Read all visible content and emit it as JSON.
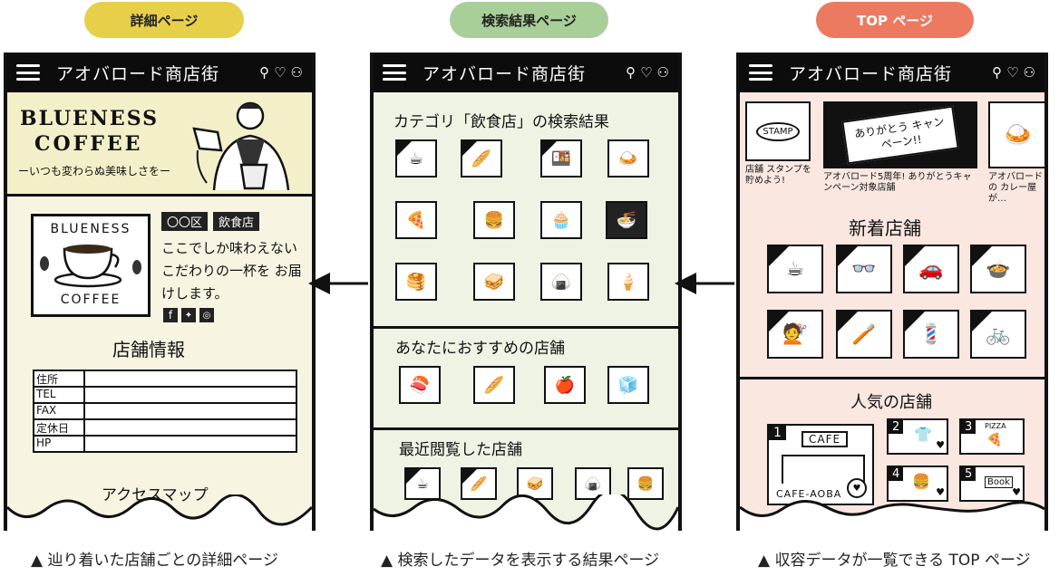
{
  "pills": [
    {
      "label": "詳細ページ",
      "color": "#e8cf4a"
    },
    {
      "label": "検索結果ページ",
      "color": "#a9cf98"
    },
    {
      "label": "TOP ページ",
      "color": "#ec7a60"
    }
  ],
  "app_title": "アオバロード商店街",
  "bar_icons": [
    "pin-icon",
    "heart-icon",
    "user-icon"
  ],
  "detail": {
    "brand_line1": "BLUENESS",
    "brand_line2": "COFFEE",
    "tagline": "ーいつも変わらぬ美味しさをー",
    "logo_top": "BLUENESS",
    "logo_bottom": "COFFEE",
    "tags": [
      "〇〇区",
      "飲食店"
    ],
    "description": "ここでしか味わえない こだわりの一杯を お届けします。",
    "info_title": "店舗情報",
    "info_rows": [
      "住所",
      "TEL",
      "FAX",
      "定休日",
      "HP"
    ],
    "access_title": "アクセスマップ"
  },
  "search": {
    "result_title": "カテゴリ「飲食店」の検索結果",
    "recommend_title": "あなたにおすすめの店舗",
    "recent_title": "最近閲覧した店舗"
  },
  "top": {
    "campaign": "ありがとう キャンペーン!!",
    "stamp": "STAMP",
    "stamp_caption": "店舗 スタンプを貯めよう!",
    "campaign_caption": "アオバロード5周年! ありがとうキャンペーン対象店舗",
    "curry_caption": "アオバロードの カレー屋が…",
    "new_title": "新着店舗",
    "popular_title": "人気の店舗",
    "cafe_sign": "CAFE",
    "cafe_name": "CAFE-AOBA",
    "ranks": [
      "1",
      "2",
      "3",
      "4",
      "5"
    ],
    "pizza": "PIZZA",
    "book": "Book",
    "bike": "BIKE"
  },
  "captions": [
    "▲ 辿り着いた店舗ごとの詳細ページ",
    "▲ 検索したデータを表示する結果ページ",
    "▲ 収容データが一覧できる TOP ページ"
  ]
}
